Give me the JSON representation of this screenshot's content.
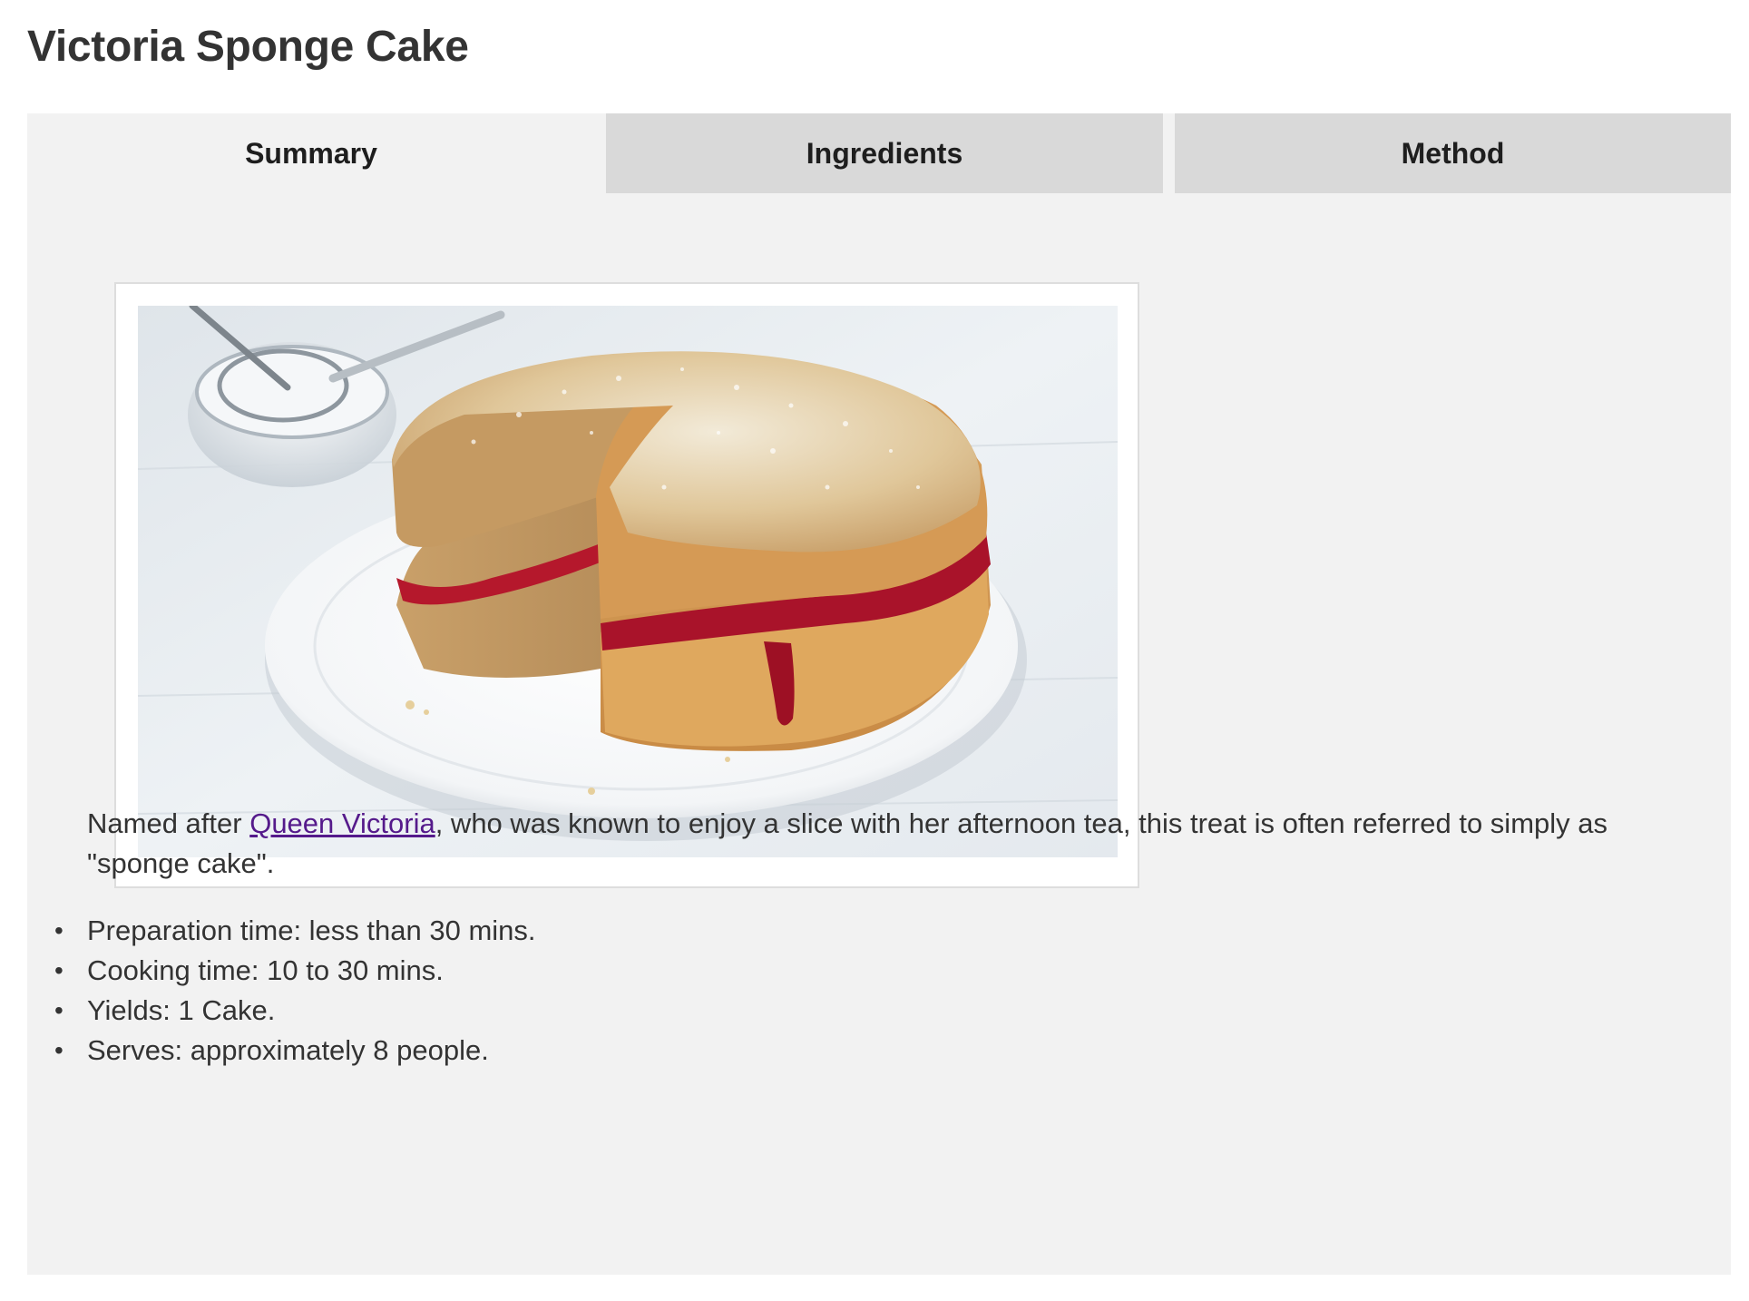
{
  "page": {
    "title": "Victoria Sponge Cake"
  },
  "tabs": [
    {
      "label": "Summary",
      "active": true
    },
    {
      "label": "Ingredients",
      "active": false
    },
    {
      "label": "Method",
      "active": false
    }
  ],
  "summary": {
    "intro_before": "Named after ",
    "intro_link": "Queen Victoria",
    "intro_after": ", who was known to enjoy a slice with her afternoon tea, this treat is often referred to simply as \"sponge cake\".",
    "facts": [
      "Preparation time: less than 30 mins.",
      "Cooking time: 10 to 30 mins.",
      "Yields: 1 Cake.",
      "Serves: approximately 8 people."
    ],
    "bullet": "•"
  },
  "colors": {
    "tab_active_bg": "#f2f2f2",
    "tab_inactive_bg": "#d9d9d9",
    "panel_bg": "#f2f2f2",
    "link": "#551a8b",
    "text": "#333333"
  }
}
